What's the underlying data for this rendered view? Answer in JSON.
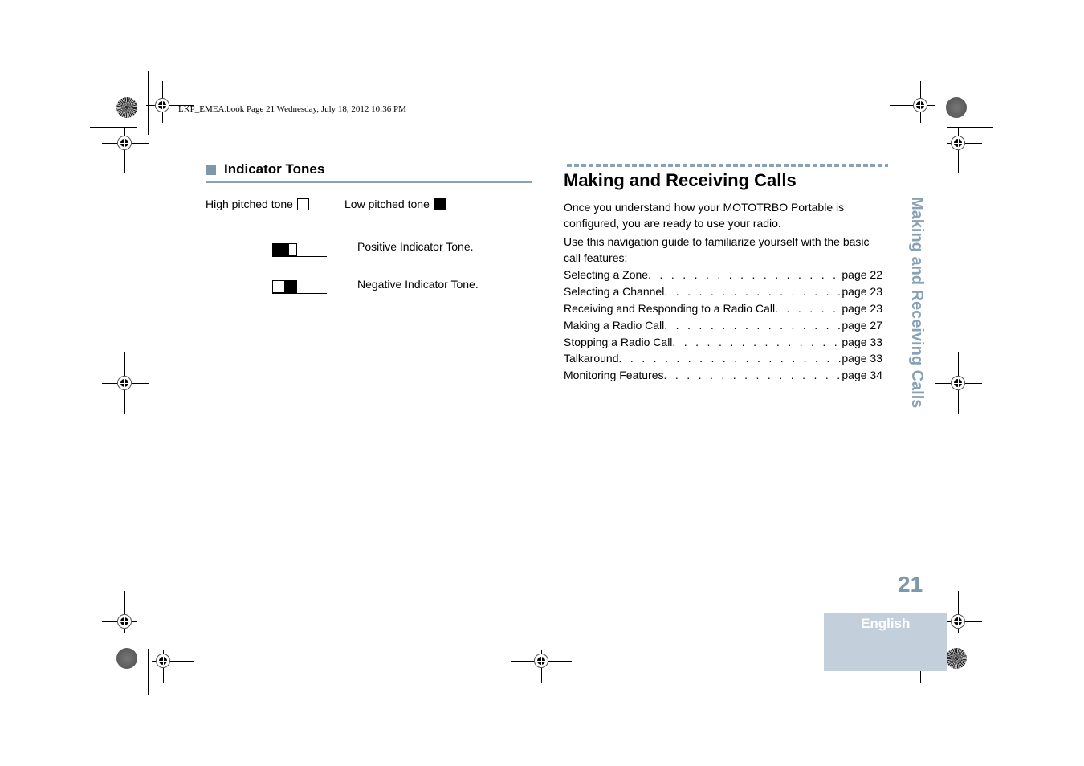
{
  "slug_line": "LKP_EMEA.book  Page 21  Wednesday, July 18, 2012  10:36 PM",
  "left_section": {
    "title": "Indicator Tones",
    "legend": {
      "high_label": "High pitched tone",
      "low_label": "Low pitched tone"
    },
    "tones": [
      {
        "label": "Positive Indicator Tone.",
        "pattern": [
          "low",
          "low",
          "high"
        ]
      },
      {
        "label": "Negative Indicator Tone.",
        "pattern": [
          "high",
          "low"
        ]
      }
    ]
  },
  "right_section": {
    "title": "Making and Receiving Calls",
    "paragraphs": [
      "Once you understand how your MOTOTRBO Portable is configured, you are ready to use your radio.",
      "Use this navigation guide to familiarize yourself with the basic call features:"
    ],
    "toc": [
      {
        "title": "Selecting a Zone",
        "page": "page 22"
      },
      {
        "title": "Selecting a Channel",
        "page": "page 23"
      },
      {
        "title": "Receiving and Responding to a Radio Call",
        "page": "page 23"
      },
      {
        "title": "Making a Radio Call",
        "page": "page 27"
      },
      {
        "title": "Stopping a Radio Call",
        "page": "page 33"
      },
      {
        "title": "Talkaround",
        "page": "page 33"
      },
      {
        "title": "Monitoring Features",
        "page": "page 34"
      }
    ],
    "toc_leader": ". . . . . . . . . . . . . . . . . . . . . . . . . . . . . . . . . . . . . . . . . . . ."
  },
  "side_tab": {
    "label": "Making and Receiving Calls"
  },
  "page_number": "21",
  "language_tab": {
    "label": "English"
  },
  "colors": {
    "accent": "#8aa0b5",
    "tab_background": "#c3cfdb",
    "page_number": "#7f97ad"
  }
}
